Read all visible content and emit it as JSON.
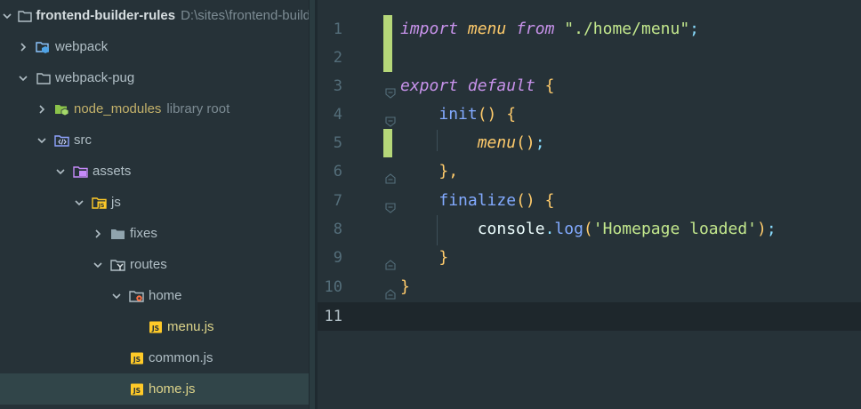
{
  "project_tree": {
    "root": {
      "name": "frontend-builder-rules",
      "path_hint": "D:\\sites\\frontend-build"
    },
    "items": [
      {
        "label": "webpack"
      },
      {
        "label": "webpack-pug"
      },
      {
        "label": "node_modules",
        "hint": "library root"
      },
      {
        "label": "src"
      },
      {
        "label": "assets"
      },
      {
        "label": "js"
      },
      {
        "label": "fixes"
      },
      {
        "label": "routes"
      },
      {
        "label": "home"
      },
      {
        "label": "menu.js"
      },
      {
        "label": "common.js"
      },
      {
        "label": "home.js"
      }
    ]
  },
  "editor": {
    "line_numbers": [
      "1",
      "2",
      "3",
      "4",
      "5",
      "6",
      "7",
      "8",
      "9",
      "10",
      "11"
    ],
    "current_line": "11",
    "code": {
      "l1": {
        "kw_import": "import",
        "id_menu": "menu",
        "kw_from": "from",
        "str_path": "\"./home/menu\"",
        "semi": ";"
      },
      "l3": {
        "kw_export": "export",
        "kw_default": "default",
        "brace": "{"
      },
      "l4": {
        "fn_init": "init",
        "parens": "()",
        "brace": "{"
      },
      "l5": {
        "id_menu": "menu",
        "parens": "()",
        "semi": ";"
      },
      "l6": {
        "close": "},"
      },
      "l7": {
        "fn_finalize": "finalize",
        "parens": "()",
        "brace": "{"
      },
      "l8": {
        "obj": "console",
        "dot": ".",
        "fn_log": "log",
        "lparen": "(",
        "str": "'Homepage loaded'",
        "rparen": ")",
        "semi": ";"
      },
      "l9": {
        "close": "}"
      },
      "l10": {
        "close": "}"
      }
    }
  },
  "colors": {
    "background": "#263238",
    "keyword": "#c792ea",
    "function": "#82aaff",
    "identifier": "#ffcb6b",
    "string": "#c3e88d",
    "punctuation": "#89ddff",
    "vcs_change": "#b5d779",
    "js_file": "#ddd48a"
  },
  "icons": {
    "expand": "chevron-down-icon",
    "collapse": "chevron-right-icon",
    "folder": "folder-icon",
    "js_file": "js-file-icon"
  }
}
